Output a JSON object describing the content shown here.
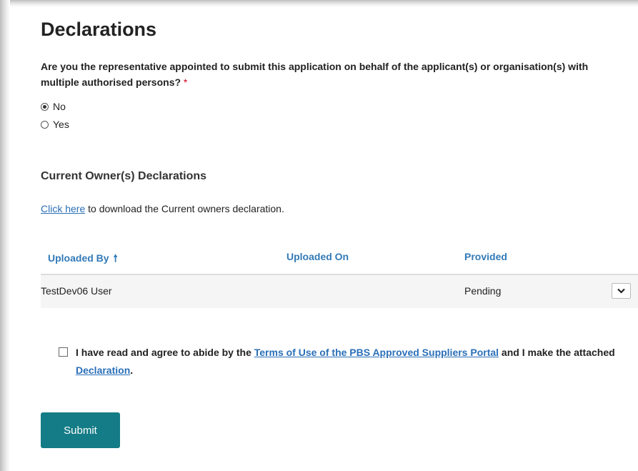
{
  "page": {
    "title": "Declarations"
  },
  "question": {
    "text": "Are you the representative appointed to submit this application on behalf of the applicant(s) or organisation(s) with multiple authorised persons?",
    "required_marker": "*",
    "options": [
      {
        "label": "No",
        "selected": true
      },
      {
        "label": "Yes",
        "selected": false
      }
    ]
  },
  "owners_section": {
    "title": "Current Owner(s) Declarations",
    "link_text": "Click here",
    "link_suffix": " to download the Current owners declaration."
  },
  "table": {
    "headers": [
      "Uploaded By",
      "Uploaded On",
      "Provided"
    ],
    "sort_icon": "arrow-up-icon",
    "rows": [
      {
        "uploaded_by": "TestDev06 User",
        "uploaded_on": "",
        "provided": "Pending",
        "expand_icon": "chevron-down-icon"
      }
    ]
  },
  "agreement": {
    "checked": false,
    "text_before": "I have read and agree to abide by the ",
    "terms_link": "Terms of Use of the PBS Approved Suppliers Portal",
    "text_middle": " and I make the attached ",
    "declaration_link": "Declaration",
    "text_after": "."
  },
  "actions": {
    "submit_label": "Submit"
  },
  "colors": {
    "accent": "#147c86",
    "link": "#2a6fb8",
    "header_text": "#337ab7",
    "required": "#d0021b"
  }
}
